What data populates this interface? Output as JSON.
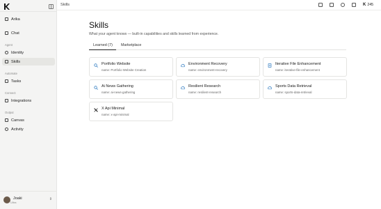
{
  "sidebar": {
    "brand": "Arika",
    "items": [
      {
        "label": "Chat",
        "icon": "chat-bubble-icon"
      },
      {
        "label": "Identity",
        "icon": "person-icon"
      },
      {
        "label": "Skills",
        "icon": "sparkle-icon"
      },
      {
        "label": "Tasks",
        "icon": "checklist-icon"
      },
      {
        "label": "Integrations",
        "icon": "plug-icon"
      },
      {
        "label": "Canvas",
        "icon": "pencil-icon"
      },
      {
        "label": "Activity",
        "icon": "activity-icon"
      }
    ],
    "sections": {
      "agent": "Agent",
      "automate": "Automate",
      "connect": "Connect",
      "output": "Output"
    },
    "user": {
      "name": "Joaki",
      "role": "Ultra"
    }
  },
  "topbar": {
    "breadcrumb": "Skills",
    "credits": "245"
  },
  "page": {
    "title": "Skills",
    "subtitle": "What your agent knows — built-in capabilities and skills learned from experience.",
    "tabs": [
      {
        "label": "Learned (7)",
        "active": true
      },
      {
        "label": "Marketplace",
        "active": false
      }
    ]
  },
  "skills": [
    {
      "name": "Portfolio Website",
      "meta": "name: Portfolio Website Creation",
      "icon": "search-icon"
    },
    {
      "name": "Environment Recovery",
      "meta": "name: environment-recovery",
      "icon": "cloud-icon"
    },
    {
      "name": "Iterative File Enhancement",
      "meta": "name: iterative-file-enhancement",
      "icon": "document-icon"
    },
    {
      "name": "Ai News Gathering",
      "meta": "name: ai-news-gathering",
      "icon": "search-icon"
    },
    {
      "name": "Resilient Research",
      "meta": "name: resilient-research",
      "icon": "cloud-icon"
    },
    {
      "name": "Sports Data Retrieval",
      "meta": "name: sports-data-retrieval",
      "icon": "cloud-icon"
    },
    {
      "name": "X Api Minimal",
      "meta": "name: x-api-minimal",
      "icon": "x-logo-icon"
    }
  ],
  "colors": {
    "accent": "#3b82c4",
    "text": "#1a1a1a",
    "muted": "#666666"
  }
}
